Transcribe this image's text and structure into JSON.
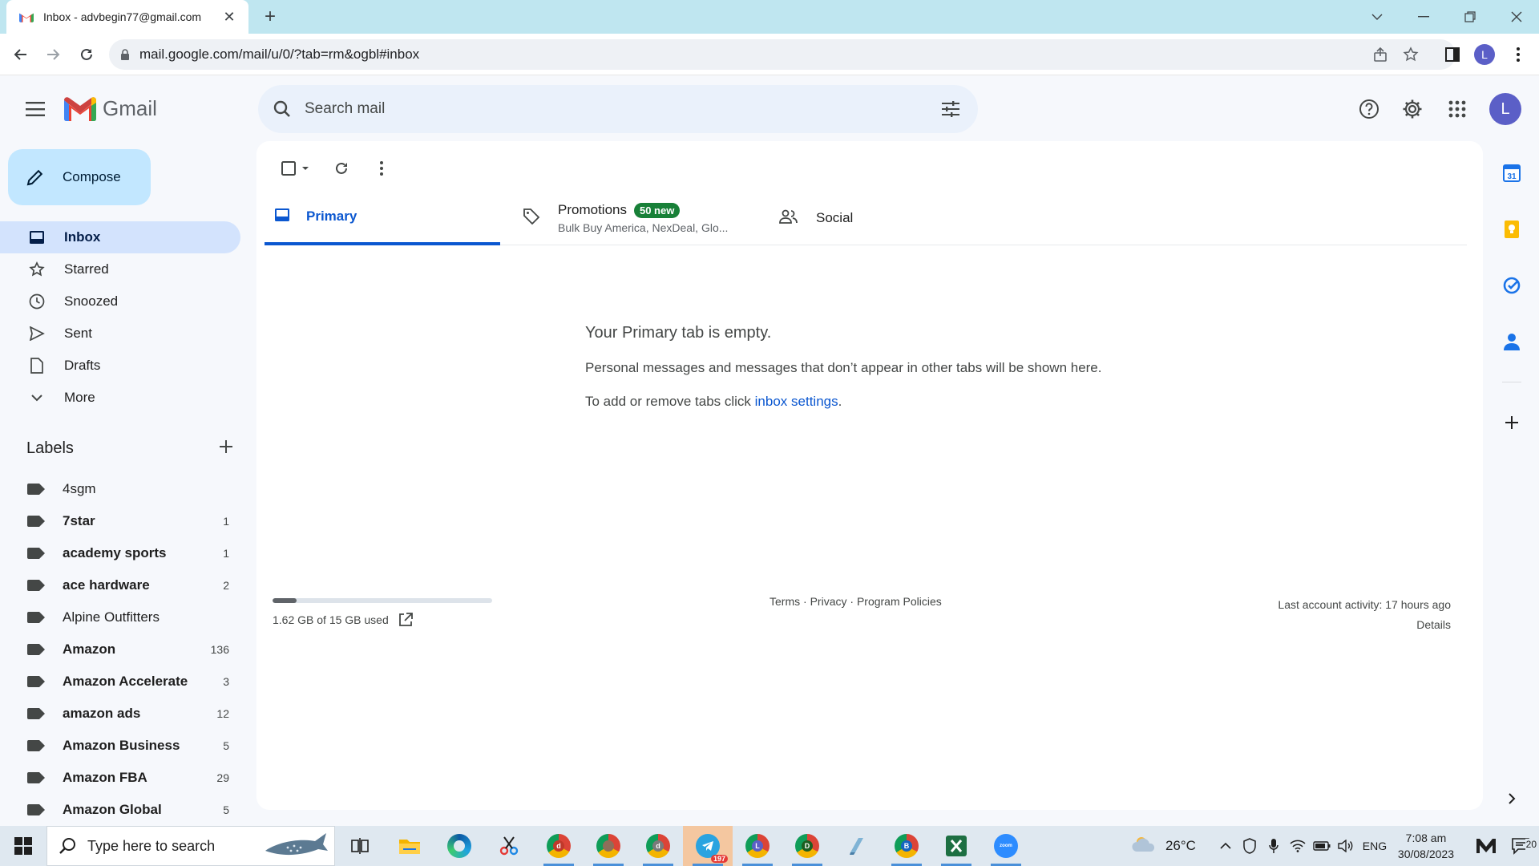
{
  "browser": {
    "tab_title": "Inbox - advbegin77@gmail.com",
    "url": "mail.google.com/mail/u/0/?tab=rm&ogbl#inbox",
    "profile_initial": "L"
  },
  "gmail": {
    "product_name": "Gmail",
    "search_placeholder": "Search mail",
    "account_initial": "L",
    "compose_label": "Compose",
    "nav": [
      {
        "label": "Inbox",
        "icon": "inbox-icon",
        "active": true
      },
      {
        "label": "Starred",
        "icon": "star-icon"
      },
      {
        "label": "Snoozed",
        "icon": "clock-icon"
      },
      {
        "label": "Sent",
        "icon": "send-icon"
      },
      {
        "label": "Drafts",
        "icon": "draft-icon"
      },
      {
        "label": "More",
        "icon": "chevron-down-icon"
      }
    ],
    "labels_heading": "Labels",
    "labels": [
      {
        "name": "4sgm",
        "count": "",
        "bold": false
      },
      {
        "name": "7star",
        "count": "1",
        "bold": true
      },
      {
        "name": "academy sports",
        "count": "1",
        "bold": true
      },
      {
        "name": "ace hardware",
        "count": "2",
        "bold": true
      },
      {
        "name": "Alpine Outfitters",
        "count": "",
        "bold": false
      },
      {
        "name": "Amazon",
        "count": "136",
        "bold": true
      },
      {
        "name": "Amazon Accelerate",
        "count": "3",
        "bold": true
      },
      {
        "name": "amazon ads",
        "count": "12",
        "bold": true
      },
      {
        "name": "Amazon Business",
        "count": "5",
        "bold": true
      },
      {
        "name": "Amazon FBA",
        "count": "29",
        "bold": true
      },
      {
        "name": "Amazon Global",
        "count": "5",
        "bold": true
      }
    ],
    "tabs": {
      "primary": "Primary",
      "promotions": "Promotions",
      "promotions_badge": "50 new",
      "promotions_senders": "Bulk Buy America, NexDeal, Glo...",
      "social": "Social"
    },
    "empty_state": {
      "heading": "Your Primary tab is empty.",
      "message": "Personal messages and messages that don’t appear in other tabs will be shown here.",
      "settings_prefix": "To add or remove tabs click ",
      "settings_link": "inbox settings",
      "settings_suffix": "."
    },
    "footer": {
      "storage_used": "1.62 GB of 15 GB used",
      "storage_fraction": 0.108,
      "terms": "Terms",
      "privacy": "Privacy",
      "policies": "Program Policies",
      "separator": " · ",
      "last_activity": "Last account activity: 17 hours ago",
      "details": "Details"
    },
    "side_panel": {
      "calendar_date": "31"
    }
  },
  "taskbar": {
    "search_placeholder": "Type here to search",
    "telegram_badge": "197",
    "weather": "26°C",
    "language": "ENG",
    "time": "7:08 am",
    "date": "30/08/2023",
    "notification_count": "20"
  },
  "colors": {
    "accent": "#0b57d0",
    "compose_bg": "#c2e7ff",
    "active_nav": "#d3e3fd",
    "badge_green": "#188038",
    "tabstrip": "#bfe6f0"
  }
}
